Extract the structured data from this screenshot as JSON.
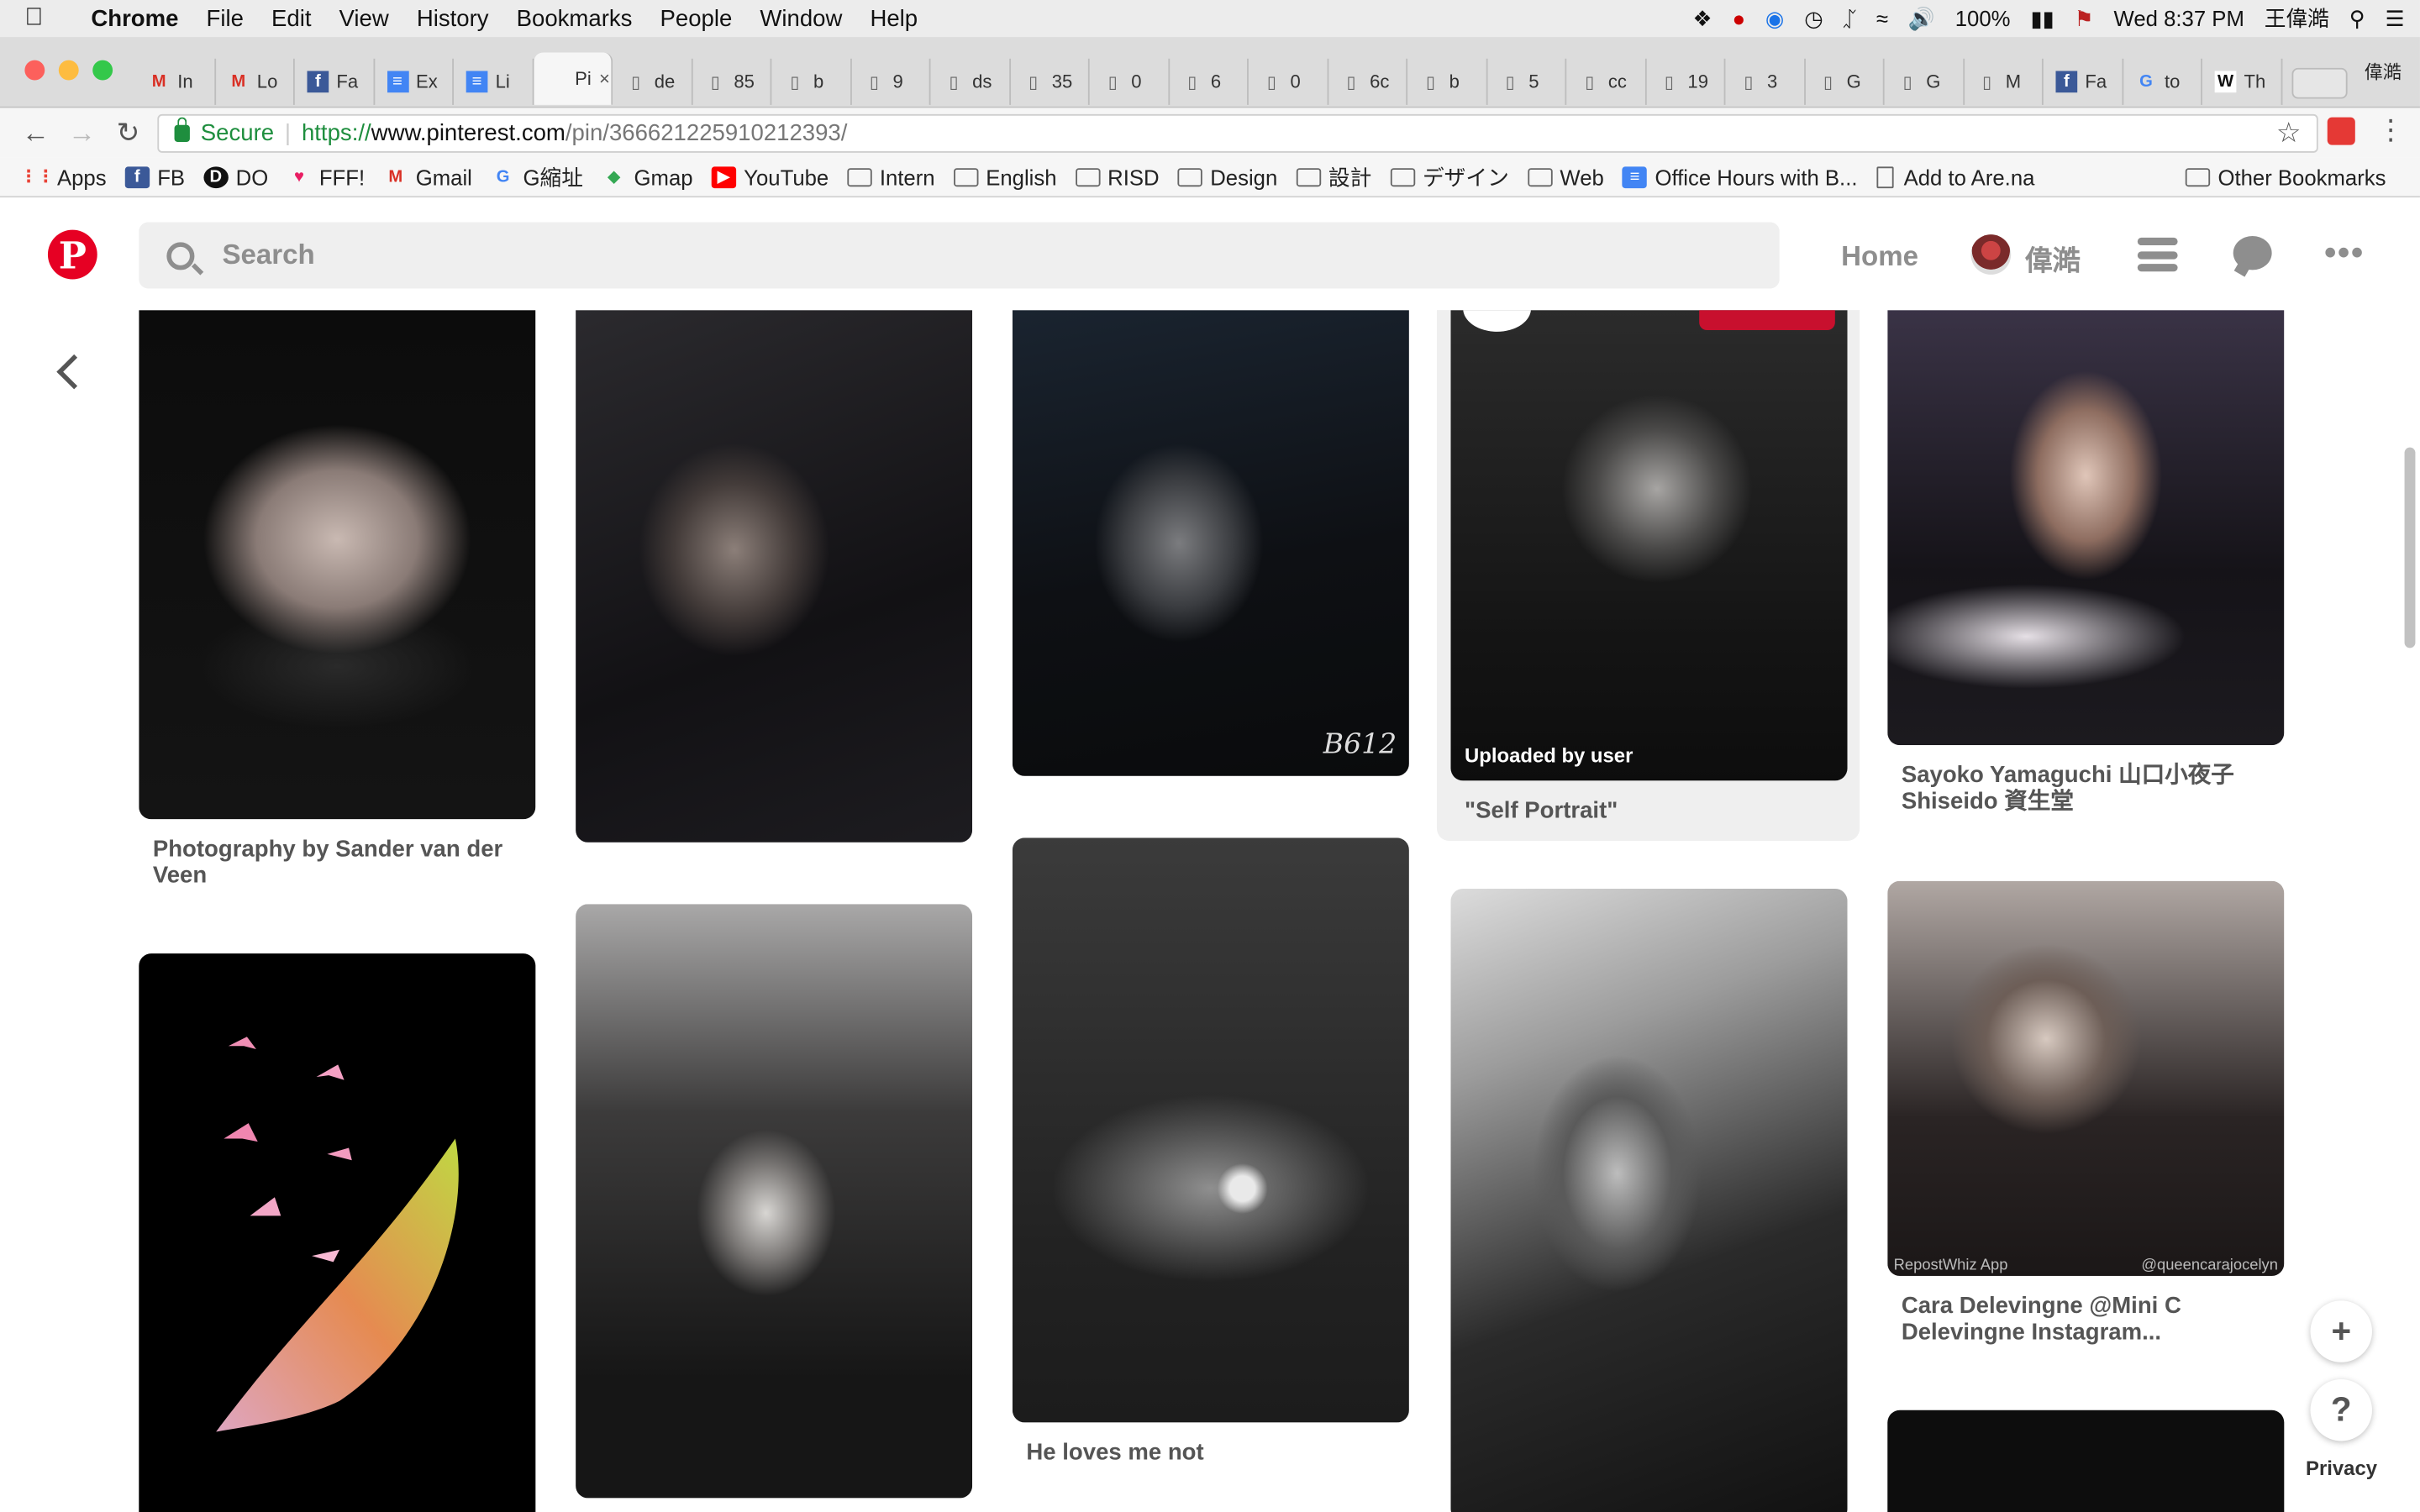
{
  "menubar": {
    "app": "Chrome",
    "items": [
      "File",
      "Edit",
      "View",
      "History",
      "Bookmarks",
      "People",
      "Window",
      "Help"
    ],
    "battery": "100%",
    "datetime": "Wed 8:37 PM",
    "user": "王偉澔"
  },
  "tabs": [
    {
      "label": "In",
      "icon": "gmail-icon"
    },
    {
      "label": "Lo",
      "icon": "gmail-icon"
    },
    {
      "label": "Fa",
      "icon": "facebook-icon"
    },
    {
      "label": "Ex",
      "icon": "docs-icon"
    },
    {
      "label": "Li",
      "icon": "docs-icon"
    },
    {
      "label": "Pi",
      "icon": "pinterest-icon",
      "active": true
    },
    {
      "label": "de",
      "icon": "page-icon"
    },
    {
      "label": "85",
      "icon": "page-icon"
    },
    {
      "label": "b",
      "icon": "page-icon"
    },
    {
      "label": "9",
      "icon": "page-icon"
    },
    {
      "label": "ds",
      "icon": "page-icon"
    },
    {
      "label": "35",
      "icon": "page-icon"
    },
    {
      "label": "0",
      "icon": "page-icon"
    },
    {
      "label": "6",
      "icon": "page-icon"
    },
    {
      "label": "0",
      "icon": "page-icon"
    },
    {
      "label": "6c",
      "icon": "page-icon"
    },
    {
      "label": "b",
      "icon": "page-icon"
    },
    {
      "label": "5",
      "icon": "page-icon"
    },
    {
      "label": "cc",
      "icon": "page-icon"
    },
    {
      "label": "19",
      "icon": "page-icon"
    },
    {
      "label": "3",
      "icon": "page-icon"
    },
    {
      "label": "G",
      "icon": "page-icon"
    },
    {
      "label": "G",
      "icon": "page-icon"
    },
    {
      "label": "M",
      "icon": "page-icon"
    },
    {
      "label": "Fa",
      "icon": "facebook-icon"
    },
    {
      "label": "to",
      "icon": "google-icon"
    },
    {
      "label": "Th",
      "icon": "wikipedia-icon"
    }
  ],
  "profile_name": "偉澔",
  "toolbar": {
    "secure_label": "Secure",
    "url_scheme": "https://",
    "url_host": "www.pinterest.com",
    "url_path": "/pin/366621225910212393/"
  },
  "bookmarks": [
    {
      "label": "Apps",
      "type": "apps"
    },
    {
      "label": "FB",
      "type": "facebook"
    },
    {
      "label": "DO",
      "type": "do"
    },
    {
      "label": "FFF!",
      "type": "heart"
    },
    {
      "label": "Gmail",
      "type": "gmail"
    },
    {
      "label": "G縮址",
      "type": "google"
    },
    {
      "label": "Gmap",
      "type": "maps"
    },
    {
      "label": "YouTube",
      "type": "youtube"
    },
    {
      "label": "Intern",
      "type": "folder"
    },
    {
      "label": "English",
      "type": "folder"
    },
    {
      "label": "RISD",
      "type": "folder"
    },
    {
      "label": "Design",
      "type": "folder"
    },
    {
      "label": "設計",
      "type": "folder"
    },
    {
      "label": "デザイン",
      "type": "folder"
    },
    {
      "label": "Web",
      "type": "folder"
    },
    {
      "label": "Office Hours with B...",
      "type": "docs"
    },
    {
      "label": "Add to Are.na",
      "type": "doc"
    }
  ],
  "other_bookmarks": "Other Bookmarks",
  "pinterest": {
    "search_placeholder": "Search",
    "home": "Home",
    "username": "偉澔"
  },
  "pins": [
    {
      "caption": "Photography by Sander van der Veen"
    },
    {
      "caption": ""
    },
    {
      "caption": ""
    },
    {
      "caption": "\"Self Portrait\"",
      "overlay": "Uploaded by user"
    },
    {
      "caption": "Sayoko Yamaguchi 山口小夜子 Shiseido 資生堂"
    },
    {
      "caption": ""
    },
    {
      "caption": ""
    },
    {
      "caption": "He loves me not"
    },
    {
      "caption": ""
    },
    {
      "caption": "Cara Delevingne @Mini C Delevingne Instagram...",
      "watermark_left": "RepostWhiz App",
      "watermark_right": "@queencarajocelyn"
    },
    {
      "caption": ""
    }
  ],
  "watermark_b612": "B612",
  "floating": {
    "plus": "+",
    "help": "?",
    "privacy": "Privacy"
  }
}
